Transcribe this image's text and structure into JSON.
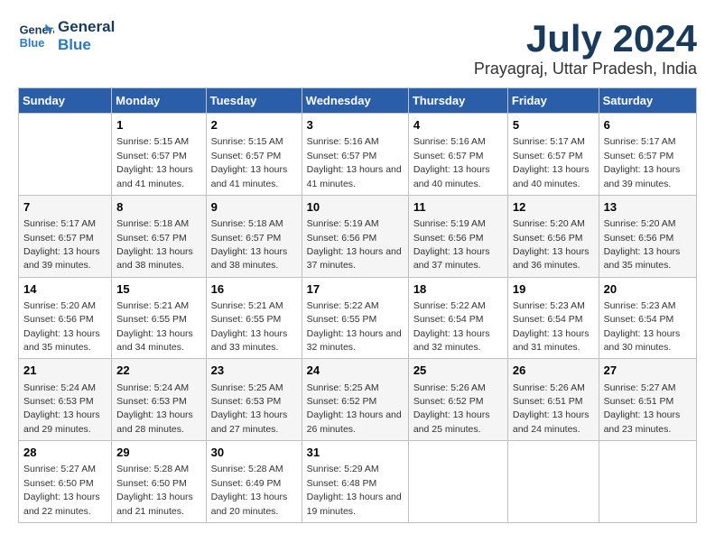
{
  "logo": {
    "line1": "General",
    "line2": "Blue"
  },
  "title": "July 2024",
  "subtitle": "Prayagraj, Uttar Pradesh, India",
  "headers": [
    "Sunday",
    "Monday",
    "Tuesday",
    "Wednesday",
    "Thursday",
    "Friday",
    "Saturday"
  ],
  "weeks": [
    [
      {
        "day": "",
        "sunrise": "",
        "sunset": "",
        "daylight": ""
      },
      {
        "day": "1",
        "sunrise": "Sunrise: 5:15 AM",
        "sunset": "Sunset: 6:57 PM",
        "daylight": "Daylight: 13 hours and 41 minutes."
      },
      {
        "day": "2",
        "sunrise": "Sunrise: 5:15 AM",
        "sunset": "Sunset: 6:57 PM",
        "daylight": "Daylight: 13 hours and 41 minutes."
      },
      {
        "day": "3",
        "sunrise": "Sunrise: 5:16 AM",
        "sunset": "Sunset: 6:57 PM",
        "daylight": "Daylight: 13 hours and 41 minutes."
      },
      {
        "day": "4",
        "sunrise": "Sunrise: 5:16 AM",
        "sunset": "Sunset: 6:57 PM",
        "daylight": "Daylight: 13 hours and 40 minutes."
      },
      {
        "day": "5",
        "sunrise": "Sunrise: 5:17 AM",
        "sunset": "Sunset: 6:57 PM",
        "daylight": "Daylight: 13 hours and 40 minutes."
      },
      {
        "day": "6",
        "sunrise": "Sunrise: 5:17 AM",
        "sunset": "Sunset: 6:57 PM",
        "daylight": "Daylight: 13 hours and 39 minutes."
      }
    ],
    [
      {
        "day": "7",
        "sunrise": "Sunrise: 5:17 AM",
        "sunset": "Sunset: 6:57 PM",
        "daylight": "Daylight: 13 hours and 39 minutes."
      },
      {
        "day": "8",
        "sunrise": "Sunrise: 5:18 AM",
        "sunset": "Sunset: 6:57 PM",
        "daylight": "Daylight: 13 hours and 38 minutes."
      },
      {
        "day": "9",
        "sunrise": "Sunrise: 5:18 AM",
        "sunset": "Sunset: 6:57 PM",
        "daylight": "Daylight: 13 hours and 38 minutes."
      },
      {
        "day": "10",
        "sunrise": "Sunrise: 5:19 AM",
        "sunset": "Sunset: 6:56 PM",
        "daylight": "Daylight: 13 hours and 37 minutes."
      },
      {
        "day": "11",
        "sunrise": "Sunrise: 5:19 AM",
        "sunset": "Sunset: 6:56 PM",
        "daylight": "Daylight: 13 hours and 37 minutes."
      },
      {
        "day": "12",
        "sunrise": "Sunrise: 5:20 AM",
        "sunset": "Sunset: 6:56 PM",
        "daylight": "Daylight: 13 hours and 36 minutes."
      },
      {
        "day": "13",
        "sunrise": "Sunrise: 5:20 AM",
        "sunset": "Sunset: 6:56 PM",
        "daylight": "Daylight: 13 hours and 35 minutes."
      }
    ],
    [
      {
        "day": "14",
        "sunrise": "Sunrise: 5:20 AM",
        "sunset": "Sunset: 6:56 PM",
        "daylight": "Daylight: 13 hours and 35 minutes."
      },
      {
        "day": "15",
        "sunrise": "Sunrise: 5:21 AM",
        "sunset": "Sunset: 6:55 PM",
        "daylight": "Daylight: 13 hours and 34 minutes."
      },
      {
        "day": "16",
        "sunrise": "Sunrise: 5:21 AM",
        "sunset": "Sunset: 6:55 PM",
        "daylight": "Daylight: 13 hours and 33 minutes."
      },
      {
        "day": "17",
        "sunrise": "Sunrise: 5:22 AM",
        "sunset": "Sunset: 6:55 PM",
        "daylight": "Daylight: 13 hours and 32 minutes."
      },
      {
        "day": "18",
        "sunrise": "Sunrise: 5:22 AM",
        "sunset": "Sunset: 6:54 PM",
        "daylight": "Daylight: 13 hours and 32 minutes."
      },
      {
        "day": "19",
        "sunrise": "Sunrise: 5:23 AM",
        "sunset": "Sunset: 6:54 PM",
        "daylight": "Daylight: 13 hours and 31 minutes."
      },
      {
        "day": "20",
        "sunrise": "Sunrise: 5:23 AM",
        "sunset": "Sunset: 6:54 PM",
        "daylight": "Daylight: 13 hours and 30 minutes."
      }
    ],
    [
      {
        "day": "21",
        "sunrise": "Sunrise: 5:24 AM",
        "sunset": "Sunset: 6:53 PM",
        "daylight": "Daylight: 13 hours and 29 minutes."
      },
      {
        "day": "22",
        "sunrise": "Sunrise: 5:24 AM",
        "sunset": "Sunset: 6:53 PM",
        "daylight": "Daylight: 13 hours and 28 minutes."
      },
      {
        "day": "23",
        "sunrise": "Sunrise: 5:25 AM",
        "sunset": "Sunset: 6:53 PM",
        "daylight": "Daylight: 13 hours and 27 minutes."
      },
      {
        "day": "24",
        "sunrise": "Sunrise: 5:25 AM",
        "sunset": "Sunset: 6:52 PM",
        "daylight": "Daylight: 13 hours and 26 minutes."
      },
      {
        "day": "25",
        "sunrise": "Sunrise: 5:26 AM",
        "sunset": "Sunset: 6:52 PM",
        "daylight": "Daylight: 13 hours and 25 minutes."
      },
      {
        "day": "26",
        "sunrise": "Sunrise: 5:26 AM",
        "sunset": "Sunset: 6:51 PM",
        "daylight": "Daylight: 13 hours and 24 minutes."
      },
      {
        "day": "27",
        "sunrise": "Sunrise: 5:27 AM",
        "sunset": "Sunset: 6:51 PM",
        "daylight": "Daylight: 13 hours and 23 minutes."
      }
    ],
    [
      {
        "day": "28",
        "sunrise": "Sunrise: 5:27 AM",
        "sunset": "Sunset: 6:50 PM",
        "daylight": "Daylight: 13 hours and 22 minutes."
      },
      {
        "day": "29",
        "sunrise": "Sunrise: 5:28 AM",
        "sunset": "Sunset: 6:50 PM",
        "daylight": "Daylight: 13 hours and 21 minutes."
      },
      {
        "day": "30",
        "sunrise": "Sunrise: 5:28 AM",
        "sunset": "Sunset: 6:49 PM",
        "daylight": "Daylight: 13 hours and 20 minutes."
      },
      {
        "day": "31",
        "sunrise": "Sunrise: 5:29 AM",
        "sunset": "Sunset: 6:48 PM",
        "daylight": "Daylight: 13 hours and 19 minutes."
      },
      {
        "day": "",
        "sunrise": "",
        "sunset": "",
        "daylight": ""
      },
      {
        "day": "",
        "sunrise": "",
        "sunset": "",
        "daylight": ""
      },
      {
        "day": "",
        "sunrise": "",
        "sunset": "",
        "daylight": ""
      }
    ]
  ]
}
